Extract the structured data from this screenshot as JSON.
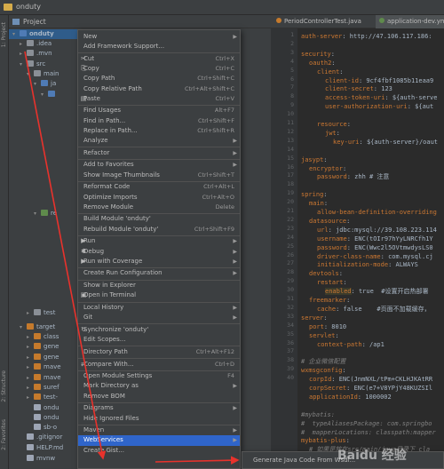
{
  "window": {
    "title": "onduty"
  },
  "project_panel": {
    "header": "Project",
    "side_labels": [
      "1: Project",
      "2: Structure",
      "2: Favorites"
    ],
    "tree": [
      {
        "label": "onduty",
        "depth": 0,
        "icon": "mod",
        "arrow": "▾"
      },
      {
        "label": ".idea",
        "depth": 1,
        "icon": "folder",
        "arrow": "▸"
      },
      {
        "label": ".mvn",
        "depth": 1,
        "icon": "folder",
        "arrow": "▸"
      },
      {
        "label": "src",
        "depth": 1,
        "icon": "folder",
        "arrow": "▾"
      },
      {
        "label": "main",
        "depth": 2,
        "icon": "folder",
        "arrow": "▾"
      },
      {
        "label": "ja",
        "depth": 3,
        "icon": "mod",
        "arrow": "▾"
      },
      {
        "label": "",
        "depth": 4,
        "icon": "mod",
        "arrow": "▾"
      },
      {
        "label": "re",
        "depth": 3,
        "icon": "green",
        "arrow": "▾"
      },
      {
        "label": "test",
        "depth": 2,
        "icon": "folder",
        "arrow": "▸"
      },
      {
        "label": "target",
        "depth": 1,
        "icon": "orange",
        "arrow": "▾"
      },
      {
        "label": "class",
        "depth": 2,
        "icon": "orange",
        "arrow": "▸"
      },
      {
        "label": "gene",
        "depth": 2,
        "icon": "orange",
        "arrow": "▸"
      },
      {
        "label": "gene",
        "depth": 2,
        "icon": "orange",
        "arrow": "▸"
      },
      {
        "label": "mave",
        "depth": 2,
        "icon": "orange",
        "arrow": "▸"
      },
      {
        "label": "mave",
        "depth": 2,
        "icon": "orange",
        "arrow": "▸"
      },
      {
        "label": "suref",
        "depth": 2,
        "icon": "orange",
        "arrow": "▸"
      },
      {
        "label": "test-",
        "depth": 2,
        "icon": "orange",
        "arrow": "▸"
      },
      {
        "label": "ondu",
        "depth": 2,
        "icon": "file",
        "arrow": ""
      },
      {
        "label": "ondu",
        "depth": 2,
        "icon": "file",
        "arrow": ""
      },
      {
        "label": "sb-o",
        "depth": 2,
        "icon": "file",
        "arrow": ""
      },
      {
        "label": ".gitignor",
        "depth": 1,
        "icon": "file",
        "arrow": ""
      },
      {
        "label": "HELP.md",
        "depth": 1,
        "icon": "file",
        "arrow": ""
      },
      {
        "label": "mvnw",
        "depth": 1,
        "icon": "file",
        "arrow": ""
      }
    ]
  },
  "editor": {
    "tabs": [
      {
        "label": "PeriodControllerTest.java",
        "color": "#c57a2c"
      },
      {
        "label": "application-dev.yml",
        "color": "#5f8b4c"
      }
    ],
    "line_numbers": [
      "1",
      "2",
      "3",
      "4",
      "5",
      "6",
      "7",
      "8",
      "9",
      "10",
      "11",
      "12",
      "13",
      "14",
      "15",
      "16",
      "17",
      "18",
      "19",
      "20",
      "21",
      "22",
      "23",
      "24",
      "25",
      "26",
      "27",
      "28",
      "29",
      "30",
      "31",
      "32",
      "33",
      "34",
      "35",
      "36",
      "37",
      "38",
      "39",
      "40"
    ],
    "lines": [
      {
        "key": "auth-server",
        "val": ": http://47.106.117.186:",
        "kind": "kv",
        "indent": 0
      },
      {
        "key": "",
        "val": "",
        "kind": "blank",
        "indent": 0
      },
      {
        "key": "security",
        "val": ":",
        "kind": "kv",
        "indent": 0
      },
      {
        "key": "oauth2",
        "val": ":",
        "kind": "kv",
        "indent": 1
      },
      {
        "key": "client",
        "val": ":",
        "kind": "kv",
        "indent": 2
      },
      {
        "key": "client-id",
        "val": ": 9cf4fbf1085b11eaa9",
        "kind": "kv",
        "indent": 3
      },
      {
        "key": "client-secret",
        "val": ": 123",
        "kind": "kv",
        "indent": 3
      },
      {
        "key": "access-token-uri",
        "val": ": ${auth-serve",
        "kind": "kv",
        "indent": 3
      },
      {
        "key": "user-authorization-uri",
        "val": ": ${aut",
        "kind": "kv",
        "indent": 3
      },
      {
        "key": "",
        "val": "",
        "kind": "blank",
        "indent": 0
      },
      {
        "key": "resource",
        "val": ":",
        "kind": "kv",
        "indent": 2
      },
      {
        "key": "jwt",
        "val": ":",
        "kind": "kv",
        "indent": 3
      },
      {
        "key": "key-uri",
        "val": ": ${auth-server}/oaut",
        "kind": "kv",
        "indent": 4
      },
      {
        "key": "",
        "val": "",
        "kind": "blank",
        "indent": 0
      },
      {
        "key": "jasypt",
        "val": ":",
        "kind": "kv",
        "indent": 0
      },
      {
        "key": "encryptor",
        "val": ":",
        "kind": "kv",
        "indent": 1
      },
      {
        "key": "password",
        "val": ": zhh # 注意",
        "kind": "kv",
        "indent": 2
      },
      {
        "key": "",
        "val": "",
        "kind": "blank",
        "indent": 0
      },
      {
        "key": "spring",
        "val": ":",
        "kind": "kv",
        "indent": 0
      },
      {
        "key": "main",
        "val": ":",
        "kind": "kv",
        "indent": 1
      },
      {
        "key": "allow-bean-definition-overriding",
        "val": "",
        "kind": "kv",
        "indent": 2
      },
      {
        "key": "datasource",
        "val": ":",
        "kind": "kv",
        "indent": 1
      },
      {
        "key": "url",
        "val": ": jdbc:mysql://39.108.223.114",
        "kind": "kv",
        "indent": 2
      },
      {
        "key": "username",
        "val": ": ENC(tOIr97hYyLNRCfh1Y",
        "kind": "kv",
        "indent": 2
      },
      {
        "key": "password",
        "val": ": ENC(Wwc2l5OVtmwdysLS0",
        "kind": "kv",
        "indent": 2
      },
      {
        "key": "driver-class-name",
        "val": ": com.mysql.cj",
        "kind": "kv",
        "indent": 2
      },
      {
        "key": "initialization-mode",
        "val": ": ALWAYS",
        "kind": "kv",
        "indent": 2
      },
      {
        "key": "devtools",
        "val": ":",
        "kind": "kv",
        "indent": 1
      },
      {
        "key": "restart",
        "val": ":",
        "kind": "kv",
        "indent": 2
      },
      {
        "key": "enabled",
        "val": ": true  #设置开启热部署",
        "kind": "kvhl",
        "indent": 3
      },
      {
        "key": "freemarker",
        "val": ":",
        "kind": "kv",
        "indent": 1
      },
      {
        "key": "cache",
        "val": ": false    #页面不加载缓存，",
        "kind": "kv",
        "indent": 2
      },
      {
        "key": "server",
        "val": ":",
        "kind": "kv",
        "indent": 0
      },
      {
        "key": "port",
        "val": ": 8010",
        "kind": "kv",
        "indent": 1
      },
      {
        "key": "servlet",
        "val": ":",
        "kind": "kv",
        "indent": 1
      },
      {
        "key": "context-path",
        "val": ": /ap1",
        "kind": "kv",
        "indent": 2
      },
      {
        "key": "",
        "val": "",
        "kind": "blank",
        "indent": 0
      },
      {
        "key": "# 企业微信配置",
        "val": "",
        "kind": "comment",
        "indent": 0
      },
      {
        "key": "wxmsgconfig",
        "val": ":",
        "kind": "kv",
        "indent": 0
      },
      {
        "key": "corpId",
        "val": ": ENC(JnmNXL/tPm+CKLHJKAtRR",
        "kind": "kv",
        "indent": 1
      },
      {
        "key": "corpSecret",
        "val": ": ENC(e7+V8YPjY48KUZSIl",
        "kind": "kv",
        "indent": 1
      },
      {
        "key": "applicationId",
        "val": ": 1000002",
        "kind": "kv",
        "indent": 1
      },
      {
        "key": "",
        "val": "",
        "kind": "blank",
        "indent": 0
      },
      {
        "key": "#mybatis:",
        "val": "",
        "kind": "comment",
        "indent": 0
      },
      {
        "key": "#  typeAliasesPackage: com.springbo",
        "val": "",
        "kind": "comment",
        "indent": 0
      },
      {
        "key": "#  mapperLocations: classpath:mapper",
        "val": "",
        "kind": "comment",
        "indent": 0
      },
      {
        "key": "mybatis-plus",
        "val": ":",
        "kind": "kv",
        "indent": 0
      },
      {
        "key": "# 如果是放在src/main/java目录下 cla",
        "val": "",
        "kind": "comment",
        "indent": 1
      },
      {
        "key": "# 如果是放在resource目录 classpath",
        "val": "",
        "kind": "comment",
        "indent": 1
      },
      {
        "key": "#实体扫描，多个package用逗号或者分号",
        "val": "",
        "kind": "comment",
        "indent": 1
      }
    ]
  },
  "context_menu": {
    "items": [
      {
        "label": "New",
        "shortcut": "",
        "submenu": true,
        "sep_before": false,
        "icon": ""
      },
      {
        "label": "Add Framework Support...",
        "shortcut": "",
        "submenu": false,
        "sep_before": false,
        "icon": ""
      },
      {
        "label": "Cut",
        "shortcut": "Ctrl+X",
        "submenu": false,
        "sep_before": true,
        "icon": "✂"
      },
      {
        "label": "Copy",
        "shortcut": "Ctrl+C",
        "submenu": false,
        "sep_before": false,
        "icon": "⎘"
      },
      {
        "label": "Copy Path",
        "shortcut": "Ctrl+Shift+C",
        "submenu": false,
        "sep_before": false,
        "icon": ""
      },
      {
        "label": "Copy Relative Path",
        "shortcut": "Ctrl+Alt+Shift+C",
        "submenu": false,
        "sep_before": false,
        "icon": ""
      },
      {
        "label": "Paste",
        "shortcut": "Ctrl+V",
        "submenu": false,
        "sep_before": false,
        "icon": "▤"
      },
      {
        "label": "Find Usages",
        "shortcut": "Alt+F7",
        "submenu": false,
        "sep_before": true,
        "icon": ""
      },
      {
        "label": "Find in Path...",
        "shortcut": "Ctrl+Shift+F",
        "submenu": false,
        "sep_before": false,
        "icon": ""
      },
      {
        "label": "Replace in Path...",
        "shortcut": "Ctrl+Shift+R",
        "submenu": false,
        "sep_before": false,
        "icon": ""
      },
      {
        "label": "Analyze",
        "shortcut": "",
        "submenu": true,
        "sep_before": false,
        "icon": ""
      },
      {
        "label": "Refactor",
        "shortcut": "",
        "submenu": true,
        "sep_before": true,
        "icon": ""
      },
      {
        "label": "Add to Favorites",
        "shortcut": "",
        "submenu": true,
        "sep_before": true,
        "icon": ""
      },
      {
        "label": "Show Image Thumbnails",
        "shortcut": "Ctrl+Shift+T",
        "submenu": false,
        "sep_before": false,
        "icon": ""
      },
      {
        "label": "Reformat Code",
        "shortcut": "Ctrl+Alt+L",
        "submenu": false,
        "sep_before": true,
        "icon": ""
      },
      {
        "label": "Optimize Imports",
        "shortcut": "Ctrl+Alt+O",
        "submenu": false,
        "sep_before": false,
        "icon": ""
      },
      {
        "label": "Remove Module",
        "shortcut": "Delete",
        "submenu": false,
        "sep_before": false,
        "icon": ""
      },
      {
        "label": "Build Module 'onduty'",
        "shortcut": "",
        "submenu": false,
        "sep_before": true,
        "icon": ""
      },
      {
        "label": "Rebuild Module 'onduty'",
        "shortcut": "Ctrl+Shift+F9",
        "submenu": false,
        "sep_before": false,
        "icon": ""
      },
      {
        "label": "Run",
        "shortcut": "",
        "submenu": true,
        "sep_before": true,
        "icon": "▶"
      },
      {
        "label": "Debug",
        "shortcut": "",
        "submenu": true,
        "sep_before": false,
        "icon": "✱"
      },
      {
        "label": "Run with Coverage",
        "shortcut": "",
        "submenu": true,
        "sep_before": false,
        "icon": "▶"
      },
      {
        "label": "Create Run Configuration",
        "shortcut": "",
        "submenu": true,
        "sep_before": true,
        "icon": ""
      },
      {
        "label": "Show in Explorer",
        "shortcut": "",
        "submenu": false,
        "sep_before": true,
        "icon": ""
      },
      {
        "label": "Open in Terminal",
        "shortcut": "",
        "submenu": false,
        "sep_before": false,
        "icon": "▣"
      },
      {
        "label": "Local History",
        "shortcut": "",
        "submenu": true,
        "sep_before": true,
        "icon": ""
      },
      {
        "label": "Git",
        "shortcut": "",
        "submenu": true,
        "sep_before": false,
        "icon": ""
      },
      {
        "label": "Synchronize 'onduty'",
        "shortcut": "",
        "submenu": false,
        "sep_before": true,
        "icon": "↻"
      },
      {
        "label": "Edit Scopes...",
        "shortcut": "",
        "submenu": false,
        "sep_before": false,
        "icon": ""
      },
      {
        "label": "Directory Path",
        "shortcut": "Ctrl+Alt+F12",
        "submenu": false,
        "sep_before": true,
        "icon": ""
      },
      {
        "label": "Compare With...",
        "shortcut": "Ctrl+D",
        "submenu": false,
        "sep_before": true,
        "icon": "⇄"
      },
      {
        "label": "Open Module Settings",
        "shortcut": "F4",
        "submenu": false,
        "sep_before": true,
        "icon": ""
      },
      {
        "label": "Mark Directory as",
        "shortcut": "",
        "submenu": true,
        "sep_before": false,
        "icon": ""
      },
      {
        "label": "Remove BOM",
        "shortcut": "",
        "submenu": false,
        "sep_before": false,
        "icon": ""
      },
      {
        "label": "Diagrams",
        "shortcut": "",
        "submenu": true,
        "sep_before": true,
        "icon": ""
      },
      {
        "label": "Hide Ignored Files",
        "shortcut": "",
        "submenu": false,
        "sep_before": false,
        "icon": ""
      },
      {
        "label": "Maven",
        "shortcut": "",
        "submenu": true,
        "sep_before": true,
        "icon": ""
      },
      {
        "label": "WebServices",
        "shortcut": "",
        "submenu": true,
        "sep_before": false,
        "icon": "",
        "active": true
      },
      {
        "label": "Create Gist...",
        "shortcut": "",
        "submenu": false,
        "sep_before": false,
        "icon": ""
      }
    ]
  },
  "submenu": {
    "label": "Generate Java Code From Wsdl..."
  },
  "watermark": {
    "text": "Baidu 经验"
  },
  "colors": {
    "accent": "#2f65ca",
    "arrow": "#e8322c"
  }
}
